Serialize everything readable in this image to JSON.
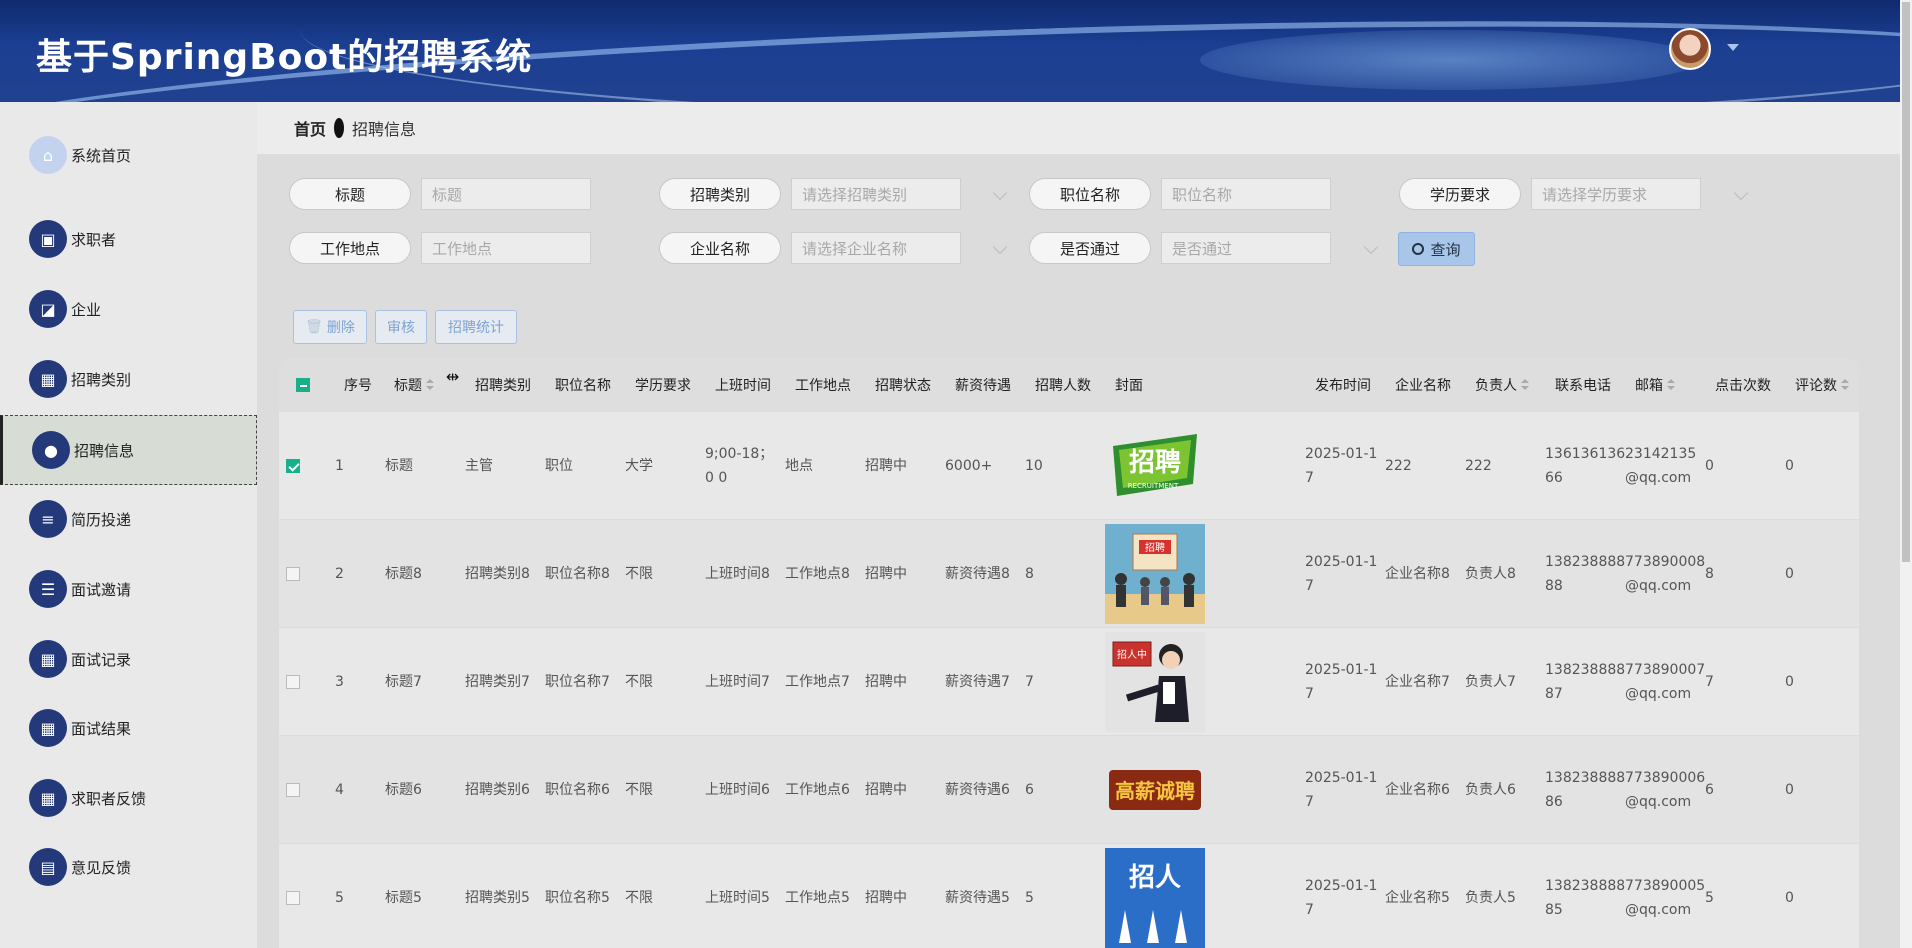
{
  "app": {
    "title": "基于SpringBoot的招聘系统"
  },
  "sidebar": {
    "items": [
      {
        "label": "系统首页",
        "icon": "home-icon",
        "glyph": "⌂"
      },
      {
        "label": "求职者",
        "icon": "monitor-icon",
        "glyph": "▣"
      },
      {
        "label": "企业",
        "icon": "chart-icon",
        "glyph": "◪"
      },
      {
        "label": "招聘类别",
        "icon": "grid-icon",
        "glyph": "▦"
      },
      {
        "label": "招聘信息",
        "icon": "user-icon",
        "glyph": "●"
      },
      {
        "label": "简历投递",
        "icon": "sliders-icon",
        "glyph": "≡"
      },
      {
        "label": "面试邀请",
        "icon": "list-icon",
        "glyph": "☰"
      },
      {
        "label": "面试记录",
        "icon": "grid-icon",
        "glyph": "▦"
      },
      {
        "label": "面试结果",
        "icon": "grid-icon",
        "glyph": "▦"
      },
      {
        "label": "求职者反馈",
        "icon": "grid-icon",
        "glyph": "▦"
      },
      {
        "label": "意见反馈",
        "icon": "table-icon",
        "glyph": "▤"
      }
    ],
    "active_index": 4
  },
  "breadcrumb": {
    "home": "首页",
    "current": "招聘信息"
  },
  "search": {
    "title": {
      "label": "标题",
      "placeholder": "标题"
    },
    "category": {
      "label": "招聘类别",
      "placeholder": "请选择招聘类别"
    },
    "position": {
      "label": "职位名称",
      "placeholder": "职位名称"
    },
    "education": {
      "label": "学历要求",
      "placeholder": "请选择学历要求"
    },
    "location": {
      "label": "工作地点",
      "placeholder": "工作地点"
    },
    "company": {
      "label": "企业名称",
      "placeholder": "请选择企业名称"
    },
    "passed": {
      "label": "是否通过",
      "placeholder": "是否通过"
    },
    "query_button": "查询"
  },
  "actions": {
    "delete": "删除",
    "review": "审核",
    "stats": "招聘统计"
  },
  "table": {
    "headers": [
      "序号",
      "标题",
      "招聘类别",
      "职位名称",
      "学历要求",
      "上班时间",
      "工作地点",
      "招聘状态",
      "薪资待遇",
      "招聘人数",
      "封面",
      "发布时间",
      "企业名称",
      "负责人",
      "联系电话",
      "邮箱",
      "点击次数",
      "评论数"
    ],
    "rows": [
      {
        "checked": true,
        "no": "1",
        "title": "标题",
        "category": "主管",
        "position": "职位",
        "education": "大学",
        "worktime": "9;00-18；0 0",
        "location": "地点",
        "status": "招聘中",
        "salary": "6000+",
        "count": "10",
        "cover": "cover-recruitment-logo",
        "date": "2025-01-1 7",
        "company": "222",
        "manager": "222",
        "phone": "136136136 66",
        "email": "23142135 @qq.com",
        "clicks": "0",
        "comments": "0"
      },
      {
        "checked": false,
        "no": "2",
        "title": "标题8",
        "category": "招聘类别8",
        "position": "职位名称8",
        "education": "不限",
        "worktime": "上班时间8",
        "location": "工作地点8",
        "status": "招聘中",
        "salary": "薪资待遇8",
        "count": "8",
        "cover": "cover-recruitment-board",
        "date": "2025-01-1 7",
        "company": "企业名称8",
        "manager": "负责人8",
        "phone": "138238888 88",
        "email": "773890008 @qq.com",
        "clicks": "8",
        "comments": "0"
      },
      {
        "checked": false,
        "no": "3",
        "title": "标题7",
        "category": "招聘类别7",
        "position": "职位名称7",
        "education": "不限",
        "worktime": "上班时间7",
        "location": "工作地点7",
        "status": "招聘中",
        "salary": "薪资待遇7",
        "count": "7",
        "cover": "cover-hiring-person",
        "date": "2025-01-1 7",
        "company": "企业名称7",
        "manager": "负责人7",
        "phone": "138238888 87",
        "email": "773890007 @qq.com",
        "clicks": "7",
        "comments": "0"
      },
      {
        "checked": false,
        "no": "4",
        "title": "标题6",
        "category": "招聘类别6",
        "position": "职位名称6",
        "education": "不限",
        "worktime": "上班时间6",
        "location": "工作地点6",
        "status": "招聘中",
        "salary": "薪资待遇6",
        "count": "6",
        "cover": "cover-gold-banner",
        "date": "2025-01-1 7",
        "company": "企业名称6",
        "manager": "负责人6",
        "phone": "138238888 86",
        "email": "773890006 @qq.com",
        "clicks": "6",
        "comments": "0"
      },
      {
        "checked": false,
        "no": "5",
        "title": "标题5",
        "category": "招聘类别5",
        "position": "职位名称5",
        "education": "不限",
        "worktime": "上班时间5",
        "location": "工作地点5",
        "status": "招聘中",
        "salary": "薪资待遇5",
        "count": "5",
        "cover": "cover-blue-hands",
        "date": "2025-01-1 7",
        "company": "企业名称5",
        "manager": "负责人5",
        "phone": "138238888 85",
        "email": "773890005 @qq.com",
        "clicks": "5",
        "comments": "0"
      }
    ]
  },
  "covers": {
    "cover-recruitment-logo": {
      "text": "招聘",
      "sub": "RECRUITMENT"
    },
    "cover-recruitment-board": {
      "text": "招聘"
    },
    "cover-hiring-person": {
      "text": "招人中"
    },
    "cover-gold-banner": {
      "text": "高薪诚聘"
    },
    "cover-blue-hands": {
      "text": "招人"
    }
  },
  "colors": {
    "header": "#1c3f93",
    "sidebar_icon": "#24397a",
    "accent": "#18b08a",
    "query": "#a8c6ea"
  }
}
